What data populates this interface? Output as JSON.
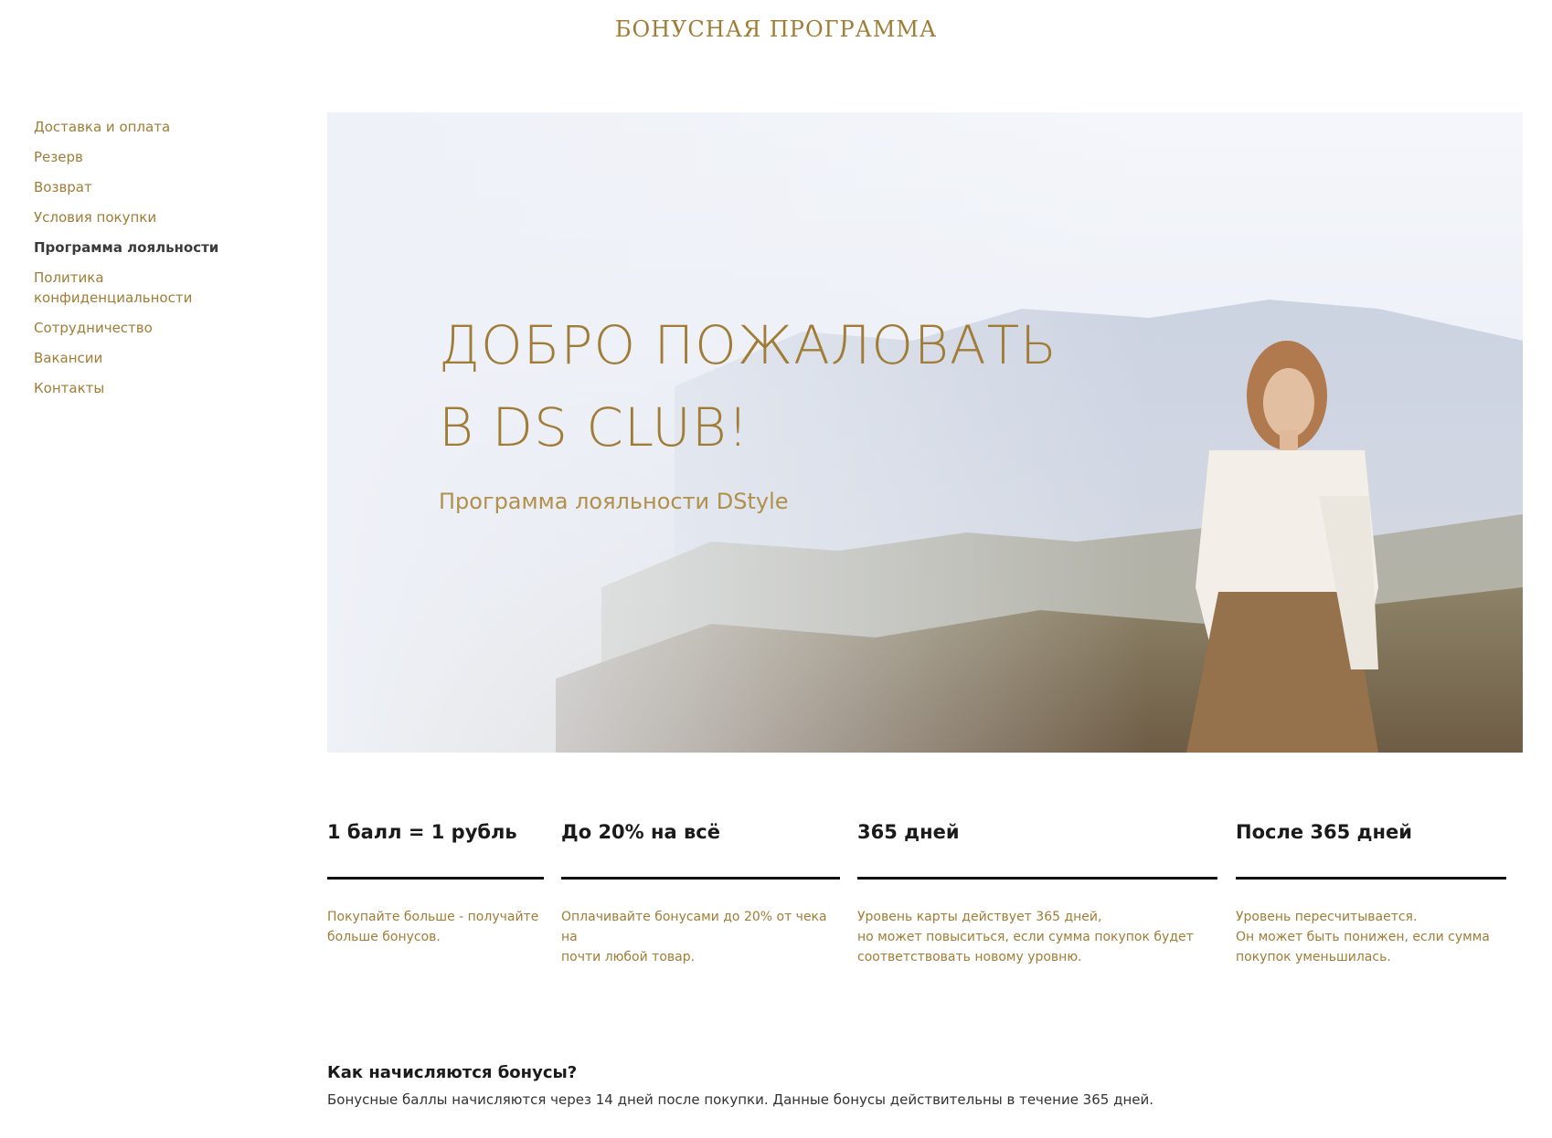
{
  "header": {
    "title": "БОНУСНАЯ ПРОГРАММА"
  },
  "sidebar": {
    "items": [
      {
        "label": "Доставка и оплата"
      },
      {
        "label": "Резерв"
      },
      {
        "label": "Возврат"
      },
      {
        "label": "Условия покупки"
      },
      {
        "label": "Программа лояльности",
        "active": true
      },
      {
        "label": "Политика конфиденциальности"
      },
      {
        "label": "Сотрудничество"
      },
      {
        "label": "Вакансии"
      },
      {
        "label": "Контакты"
      }
    ]
  },
  "hero": {
    "heading_line1": "ДОБРО ПОЖАЛОВАТЬ",
    "heading_line2": "В DS CLUB!",
    "subheading": "Программа лояльности DStyle"
  },
  "features": [
    {
      "title": "1 балл = 1 рубль",
      "description": "Покупайте больше - получайте\nбольше бонусов."
    },
    {
      "title": "До 20% на всё",
      "description": "Оплачивайте бонусами до 20% от чека на\nпочти любой товар."
    },
    {
      "title": "365 дней",
      "description": "Уровень карты действует 365 дней,\nно может повыситься, если сумма покупок будет\nсоответствовать новому уровню."
    },
    {
      "title": "После 365 дней",
      "description": "Уровень пересчитывается.\nОн может быть понижен, если сумма\nпокупок уменьшилась."
    }
  ],
  "faq": {
    "question": "Как начисляются бонусы?",
    "answer": "Бонусные баллы начисляются через 14 дней после покупки. Данные бонусы действительны в течение 365 дней."
  },
  "colors": {
    "accent": "#a07c36",
    "text": "#1a1a1a"
  }
}
